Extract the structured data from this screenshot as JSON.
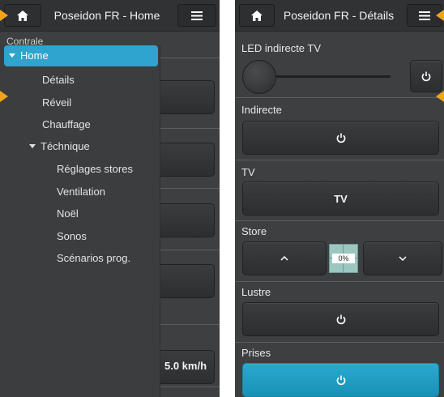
{
  "left": {
    "title": "Poseidon FR - Home",
    "section_behind": "Contrale",
    "speed_value": "5.0 km/h",
    "menu": {
      "items": [
        {
          "label": "Home",
          "selected": true,
          "caret": true
        },
        {
          "label": "Détails"
        },
        {
          "label": "Réveil"
        },
        {
          "label": "Chauffage"
        },
        {
          "label": "Téchnique",
          "caret": true
        },
        {
          "label": "Réglages stores"
        },
        {
          "label": "Ventilation"
        },
        {
          "label": "Noël"
        },
        {
          "label": "Sonos"
        },
        {
          "label": "Scénarios prog."
        }
      ]
    }
  },
  "right": {
    "title": "Poseidon FR - Détails",
    "led": {
      "label": "LED indirecte TV",
      "level": 0
    },
    "sections": {
      "indirecte": {
        "label": "Indirecte"
      },
      "tv": {
        "label": "TV",
        "button": "TV"
      },
      "store": {
        "label": "Store",
        "percent": "0%"
      },
      "lustre": {
        "label": "Lustre"
      },
      "prises": {
        "label": "Prises"
      }
    }
  },
  "icons": {
    "home": "home-icon",
    "menu": "hamburger-menu-icon",
    "power": "power-icon",
    "up": "chevron-up-icon",
    "down": "chevron-down-icon"
  },
  "colors": {
    "accent": "#2fa4cc",
    "highlight_arrow": "#f2a31b",
    "panel": "#3d3f40",
    "topbar": "#303234"
  }
}
